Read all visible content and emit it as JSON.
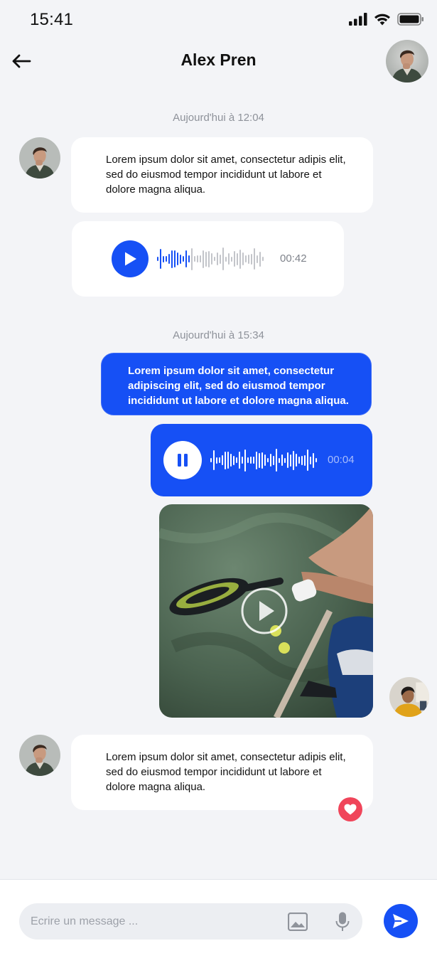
{
  "status_bar": {
    "time": "15:41"
  },
  "header": {
    "title": "Alex Pren"
  },
  "conversation": {
    "groups": [
      {
        "timestamp": "Aujourd'hui à 12:04",
        "messages": [
          {
            "type": "text",
            "direction": "incoming",
            "text": "Lorem ipsum dolor sit amet, consectetur adipis elit, sed do eiusmod tempor incididunt ut labore et dolore magna aliqua."
          },
          {
            "type": "audio",
            "direction": "incoming",
            "state": "paused",
            "duration": "00:42",
            "progress": 0.3
          }
        ]
      },
      {
        "timestamp": "Aujourd'hui à 15:34",
        "messages": [
          {
            "type": "text",
            "direction": "outgoing",
            "text": "Lorem ipsum dolor sit amet, consectetur adipiscing elit, sed do eiusmod tempor incididunt ut labore et dolore magna aliqua."
          },
          {
            "type": "audio",
            "direction": "outgoing",
            "state": "playing",
            "duration": "00:04"
          },
          {
            "type": "video",
            "direction": "outgoing",
            "icon": "play-icon"
          },
          {
            "type": "text",
            "direction": "incoming",
            "text": "Lorem ipsum dolor sit amet, consectetur adipis elit, sed do eiusmod tempor incididunt ut labore et dolore magna aliqua.",
            "reaction": "heart-icon"
          }
        ]
      }
    ]
  },
  "composer": {
    "placeholder": "Ecrire un message ...",
    "icons": [
      "image-icon",
      "microphone-icon",
      "send-icon"
    ]
  },
  "colors": {
    "accent": "#1650f5",
    "background": "#f3f4f7",
    "reaction": "#f0455a"
  }
}
